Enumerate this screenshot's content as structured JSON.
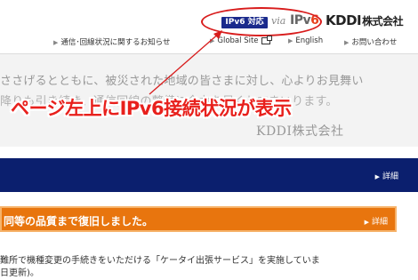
{
  "header": {
    "ipv6_badge": "IPv6 対応",
    "via": "via",
    "ipv6_logo_prefix": "IPv",
    "ipv6_logo_six": "6",
    "kddi_logo": "KDDI",
    "kddi_company": "株式会社"
  },
  "util_nav": {
    "items": [
      "通信･回線状況に関するお知らせ",
      "Global Site",
      "English",
      "お問い合わせ"
    ]
  },
  "notice": {
    "line1": "ささげるとともに、被災された地域の皆さまに対し、心よりお見舞い",
    "line2": "降りも引き続き、通信回線の整備に全力を尽くしてまいります。",
    "signature": "KDDI株式会社"
  },
  "annotation": "ページ左上にIPv6接続状況が表示",
  "blue_bar": {
    "detail_label": "詳細"
  },
  "orange_bar": {
    "text": "同等の品質まで復旧しました。",
    "detail_label": "詳細"
  },
  "body": {
    "line1": "難所で機種変更の手続きをいただける「ケータイ出張サービス」を実施していま",
    "line2": "日更新)。"
  },
  "colors": {
    "ipv6_badge": "#1a2a8c",
    "annotation_red": "#e8201c",
    "blue_bar": "#0b1f6e",
    "orange_bar": "#e8750e"
  }
}
